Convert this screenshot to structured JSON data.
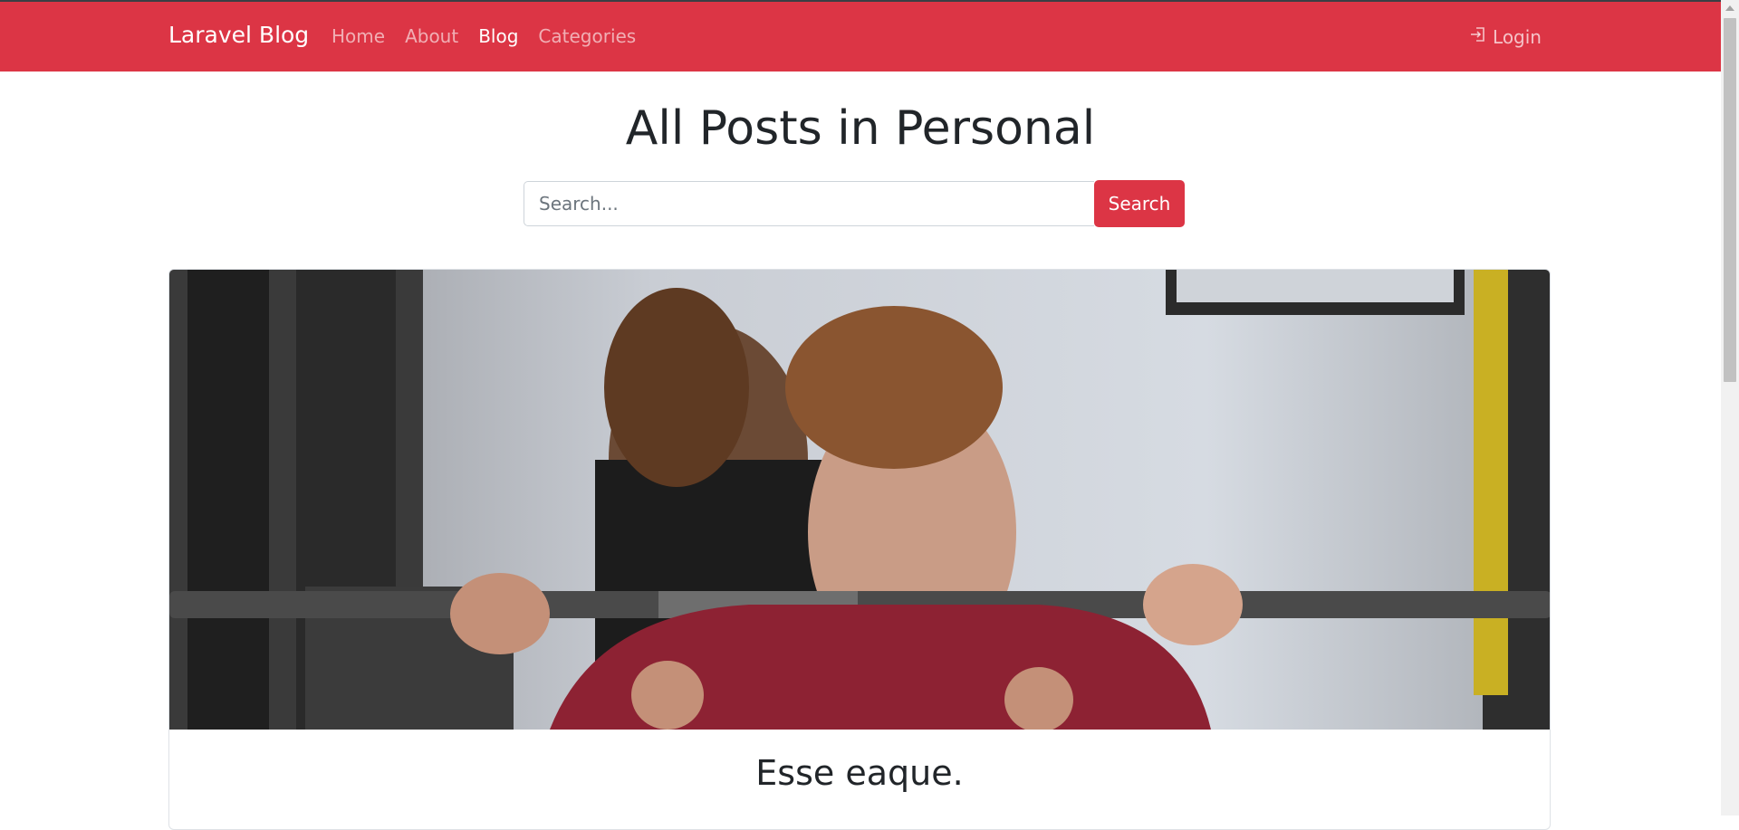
{
  "navbar": {
    "brand": "Laravel Blog",
    "links": [
      {
        "label": "Home",
        "active": false
      },
      {
        "label": "About",
        "active": false
      },
      {
        "label": "Blog",
        "active": true
      },
      {
        "label": "Categories",
        "active": false
      }
    ],
    "login_label": "Login",
    "login_icon": "login-icon",
    "color": "#dc3545"
  },
  "main": {
    "title": "All Posts in Personal",
    "search": {
      "placeholder": "Search...",
      "value": "",
      "button_label": "Search"
    },
    "posts": [
      {
        "title": "Esse eaque."
      }
    ]
  }
}
